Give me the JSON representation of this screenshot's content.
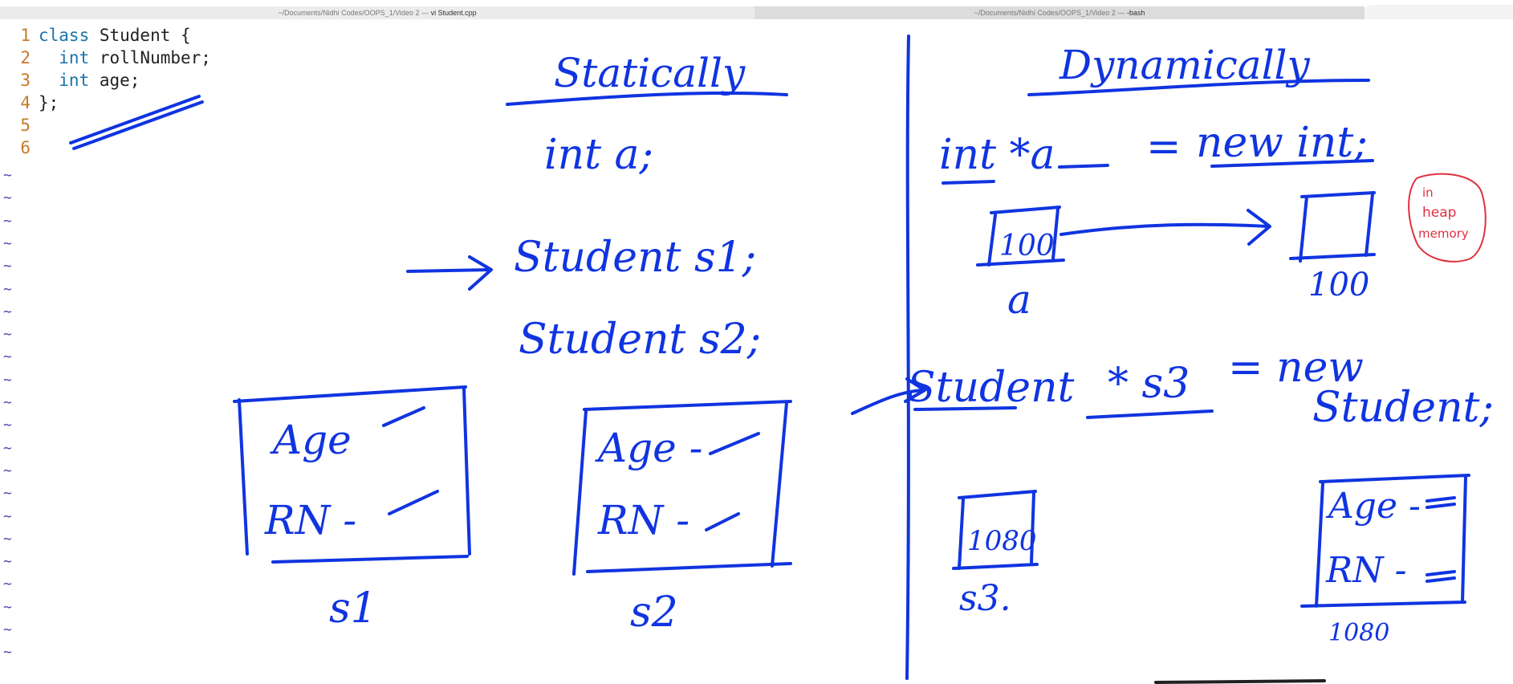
{
  "window": {
    "left_title_path": "~/Documents/Nidhi Codes/OOPS_1/Video 2 — ",
    "left_title_file": "vi Student.cpp",
    "right_title_path": "~/Documents/Nidhi Codes/OOPS_1/Video 2 — ",
    "right_title_file": "-bash"
  },
  "editor": {
    "lines": [
      {
        "num": "1",
        "kw": "class",
        "rest": " Student {"
      },
      {
        "num": "2",
        "kw": "  int",
        "rest": " rollNumber;"
      },
      {
        "num": "3",
        "kw": "  int",
        "rest": " age;"
      },
      {
        "num": "4",
        "kw": "",
        "rest": "};"
      },
      {
        "num": "5",
        "kw": "",
        "rest": ""
      },
      {
        "num": "6",
        "kw": "",
        "rest": ""
      }
    ],
    "empty_marker": "~"
  },
  "annotations": {
    "statically": {
      "heading": "Statically",
      "decl_int": "int a;",
      "decl_s1": "Student s1;",
      "decl_s2": "Student s2;",
      "box1_age": "Age",
      "box1_rn": "RN -",
      "box1_label": "s1",
      "box2_age": "Age -",
      "box2_rn": "RN -",
      "box2_label": "s2"
    },
    "dynamically": {
      "heading": "Dynamically",
      "stmt1_lhs": "int *a",
      "stmt1_eq": "=",
      "stmt1_rhs": "new int;",
      "heap_note": [
        "in",
        "heap",
        "memory"
      ],
      "ptr_value": "100",
      "ptr_name": "a",
      "heap_addr": "100",
      "stmt2_lhs": "Student",
      "stmt2_ptr": "* s3",
      "stmt2_eq": "= new",
      "stmt2_rhs": "Student;",
      "ptr2_value": "1080",
      "ptr2_name": "s3.",
      "box3_age": "Age -",
      "box3_rn": "RN -",
      "box3_addr": "1080"
    },
    "ink_color": "#1034e0",
    "note_color": "#e03040"
  }
}
